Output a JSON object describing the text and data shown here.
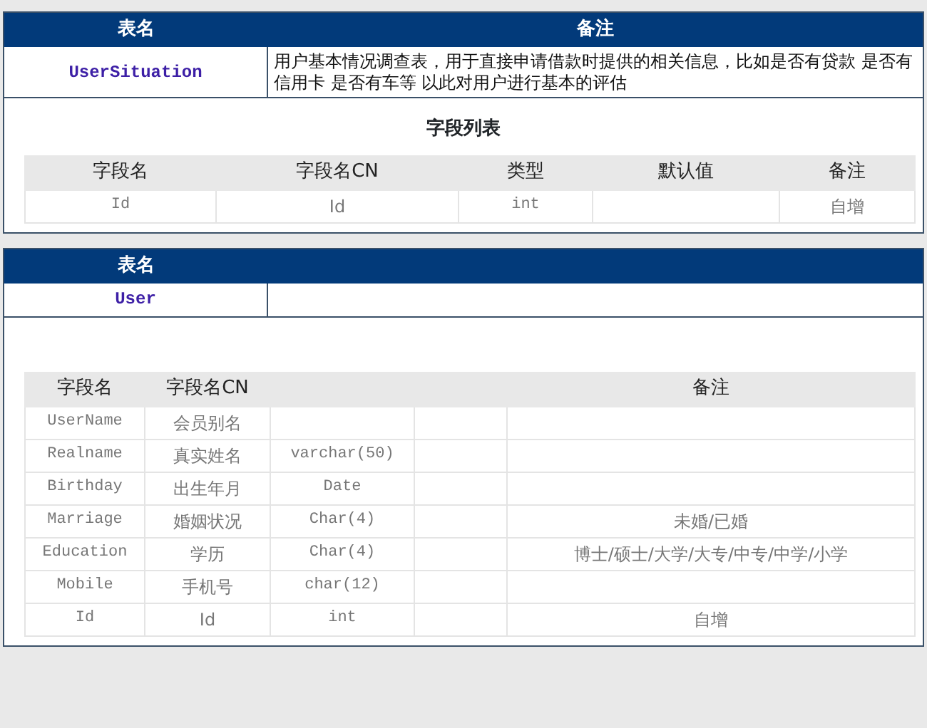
{
  "tables": [
    {
      "header": {
        "name_label": "表名",
        "remark_label": "备注"
      },
      "name": "UserSituation",
      "remark": "用户基本情况调查表，用于直接申请借款时提供的相关信息，比如是否有贷款 是否有信用卡 是否有车等 以此对用户进行基本的评估",
      "fields_title": "字段列表",
      "columns": [
        "字段名",
        "字段名CN",
        "类型",
        "默认值",
        "备注"
      ],
      "rows": [
        [
          "Id",
          "Id",
          "int",
          null,
          "自增"
        ]
      ]
    },
    {
      "header": {
        "name_label": "表名"
      },
      "name": "User",
      "columns": [
        "字段名",
        "字段名CN",
        null,
        null,
        "备注"
      ],
      "rows": [
        [
          "UserName",
          "会员别名",
          null,
          null,
          null
        ],
        [
          "Realname",
          "真实姓名",
          "varchar(50)",
          null,
          null
        ],
        [
          "Birthday",
          "出生年月",
          "Date",
          null,
          null
        ],
        [
          "Marriage",
          "婚姻状况",
          "Char(4)",
          null,
          "未婚/已婚"
        ],
        [
          "Education",
          "学历",
          "Char(4)",
          null,
          "博士/硕士/大学/大专/中专/中学/小学"
        ],
        [
          "Mobile",
          "手机号",
          "char(12)",
          null,
          null
        ],
        [
          "Id",
          "Id",
          "int",
          null,
          "自增"
        ]
      ]
    }
  ]
}
